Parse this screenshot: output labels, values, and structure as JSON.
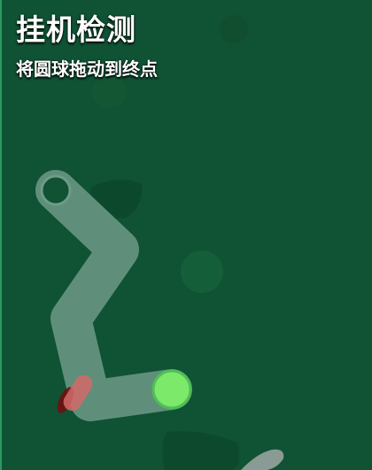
{
  "header": {
    "title": "挂机检测",
    "subtitle": "将圆球拖动到终点"
  },
  "colors": {
    "background": "#0f5234",
    "path": "#5f8f7a",
    "ball": "#7ce96a",
    "ball_ring": "#4fbf55",
    "hazard": "#d46a6a",
    "hazard_shadow": "#7a1414",
    "decor_blob": "#1a6a3e"
  },
  "icons": {
    "goal": "ring-icon",
    "ball": "circle-icon",
    "hazard": "red-capsule-icon"
  }
}
